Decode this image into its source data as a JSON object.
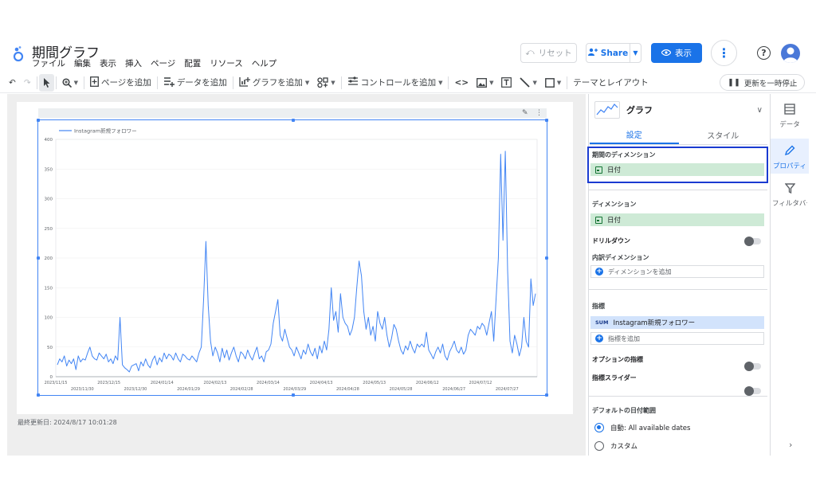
{
  "header": {
    "title": "期間グラフ",
    "menus": [
      "ファイル",
      "編集",
      "表示",
      "挿入",
      "ページ",
      "配置",
      "リソース",
      "ヘルプ"
    ],
    "reset_label": "リセット",
    "share_label": "Share",
    "view_label": "表示"
  },
  "toolbar": {
    "add_page": "ページを追加",
    "add_data": "データを追加",
    "add_chart": "グラフを追加",
    "add_control": "コントロールを追加",
    "theme_layout": "テーマとレイアウト",
    "pause_updates": "更新を一時停止"
  },
  "canvas": {
    "last_updated": "最終更新日: 2024/8/17 10:01:28"
  },
  "chart_data": {
    "type": "line",
    "title": "",
    "xlabel": "",
    "ylabel": "",
    "series": [
      {
        "name": "Instagram新規フォロワー"
      }
    ],
    "ylim": [
      0,
      400
    ],
    "y_ticks": [
      0,
      50,
      100,
      150,
      200,
      250,
      300,
      350,
      400
    ],
    "x_ticks_upper": [
      "2023/11/15",
      "2023/12/15",
      "2024/01/14",
      "2024/02/13",
      "2024/03/14",
      "2024/04/13",
      "2024/05/13",
      "2024/06/12",
      "2024/07/12"
    ],
    "x_ticks_lower": [
      "2023/11/30",
      "2023/12/30",
      "2024/01/29",
      "2024/02/28",
      "2024/03/29",
      "2024/04/28",
      "2024/05/28",
      "2024/06/27",
      "2024/07/27"
    ],
    "x_start": "2023/11/15",
    "x_end": "2024/08/13",
    "values": [
      20,
      30,
      25,
      35,
      18,
      28,
      22,
      30,
      12,
      35,
      25,
      30,
      28,
      40,
      50,
      35,
      30,
      28,
      40,
      35,
      30,
      38,
      25,
      30,
      22,
      35,
      28,
      100,
      20,
      15,
      12,
      8,
      18,
      20,
      22,
      10,
      25,
      18,
      30,
      20,
      15,
      28,
      35,
      20,
      32,
      25,
      40,
      30,
      38,
      35,
      28,
      40,
      30,
      25,
      38,
      35,
      30,
      28,
      35,
      30,
      25,
      40,
      50,
      130,
      228,
      120,
      60,
      35,
      50,
      40,
      25,
      48,
      32,
      45,
      28,
      40,
      50,
      35,
      25,
      42,
      38,
      30,
      45,
      35,
      28,
      40,
      50,
      30,
      35,
      25,
      42,
      45,
      55,
      90,
      110,
      130,
      70,
      60,
      80,
      65,
      50,
      45,
      35,
      50,
      40,
      30,
      45,
      38,
      55,
      42,
      35,
      48,
      30,
      52,
      40,
      60,
      45,
      80,
      150,
      95,
      110,
      75,
      140,
      100,
      90,
      85,
      70,
      80,
      100,
      150,
      195,
      170,
      110,
      80,
      100,
      70,
      85,
      60,
      110,
      90,
      80,
      100,
      70,
      50,
      65,
      88,
      80,
      60,
      45,
      38,
      52,
      45,
      60,
      48,
      40,
      55,
      50,
      55,
      50,
      75,
      45,
      38,
      30,
      42,
      50,
      40,
      55,
      35,
      28,
      42,
      50,
      60,
      45,
      40,
      50,
      38,
      45,
      70,
      80,
      75,
      70,
      85,
      80,
      90,
      85,
      70,
      90,
      110,
      60,
      130,
      200,
      375,
      230,
      380,
      180,
      60,
      40,
      70,
      55,
      35,
      50,
      100,
      60,
      50,
      165,
      120,
      140
    ]
  },
  "panel": {
    "chart_type": "グラフ",
    "tab_setup": "設定",
    "tab_style": "スタイル",
    "date_dim_label": "期間のディメンション",
    "date_dim_value": "日付",
    "dimension_label": "ディメンション",
    "dimension_value": "日付",
    "drilldown_label": "ドリルダウン",
    "breakdown_label": "内訳ディメンション",
    "breakdown_add": "ディメンションを追加",
    "metric_label": "指標",
    "metric_agg": "SUM",
    "metric_value": "Instagram新規フォロワー",
    "metric_add": "指標を追加",
    "optional_metric_label": "オプションの指標",
    "metric_slider_label": "指標スライダー",
    "default_range_label": "デフォルトの日付範囲",
    "auto_label": "自動: All available dates",
    "custom_label": "カスタム"
  },
  "rail": {
    "data": "データ",
    "properties": "プロパティ",
    "filter": "フィルタバー"
  },
  "colors": {
    "accent": "#1a73e8",
    "series": "#4285f4"
  }
}
